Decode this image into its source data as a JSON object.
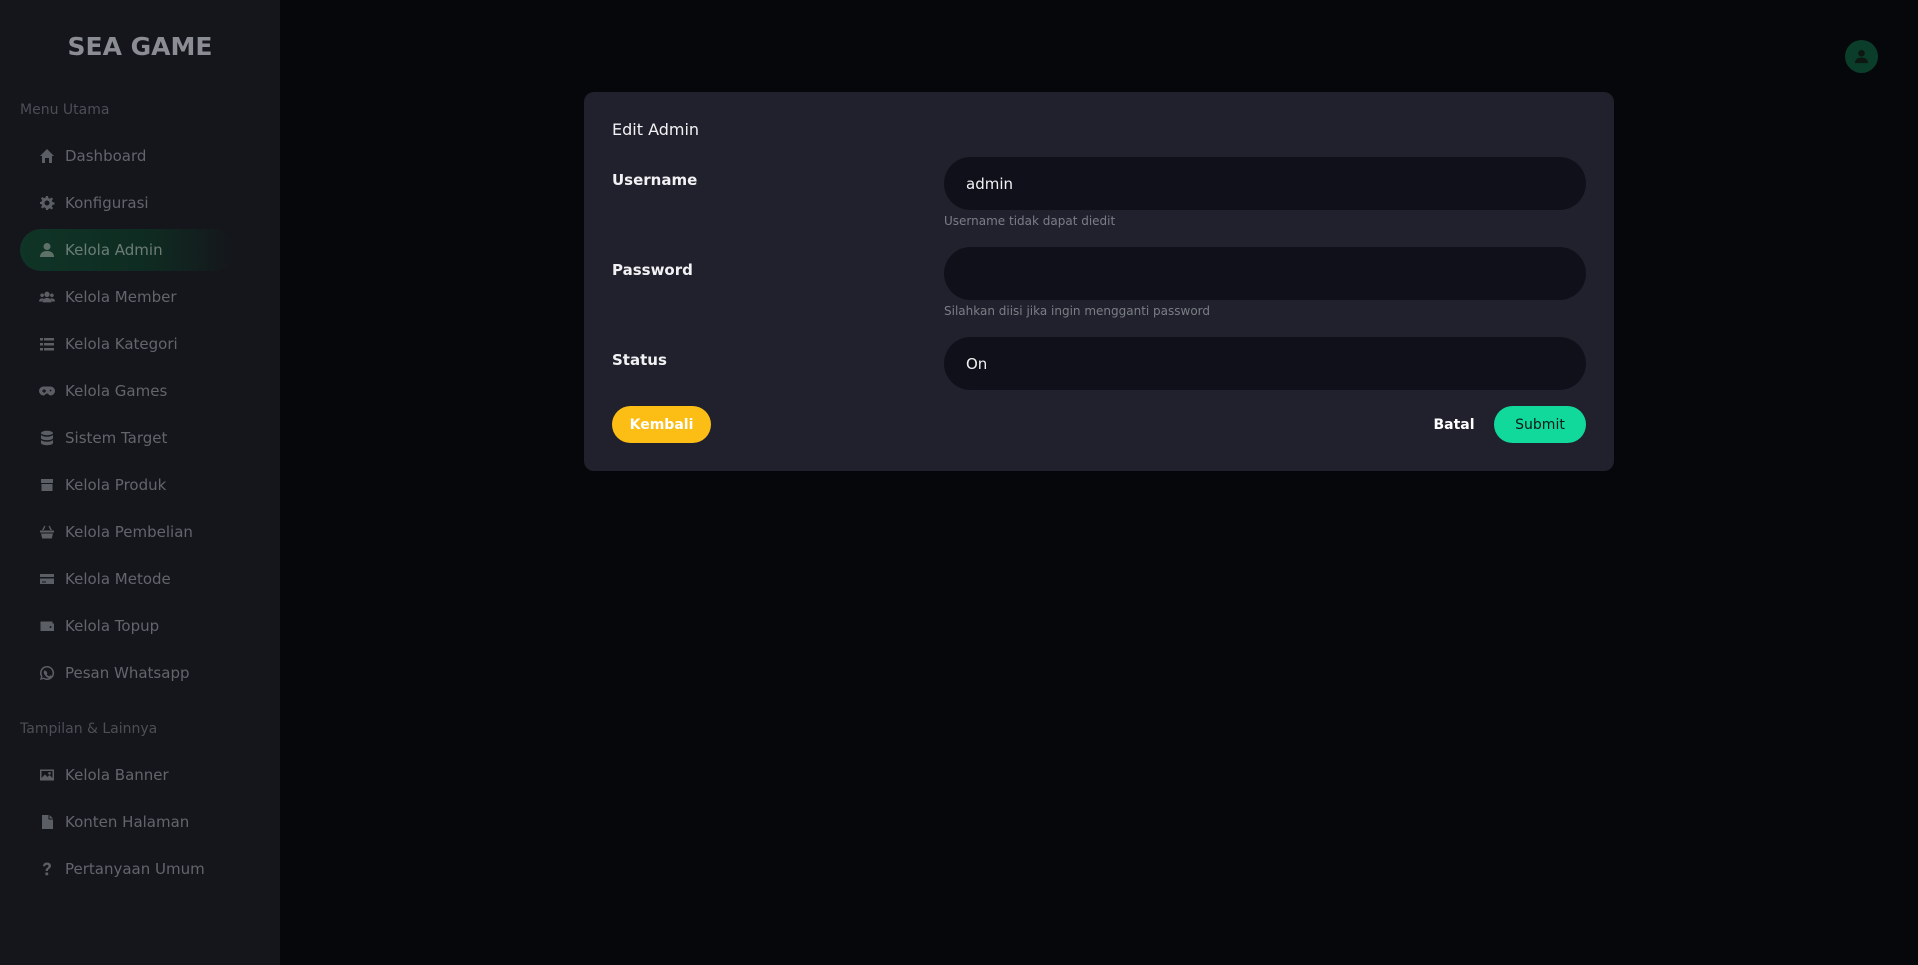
{
  "sidebar": {
    "logo": "SEA GAME",
    "sections": [
      {
        "title": "Menu Utama"
      },
      {
        "title": "Tampilan & Lainnya"
      }
    ],
    "items": [
      {
        "label": "Dashboard",
        "icon": "home-icon"
      },
      {
        "label": "Konfigurasi",
        "icon": "gear-icon"
      },
      {
        "label": "Kelola Admin",
        "icon": "user-icon",
        "active": true
      },
      {
        "label": "Kelola Member",
        "icon": "users-icon"
      },
      {
        "label": "Kelola Kategori",
        "icon": "list-icon"
      },
      {
        "label": "Kelola Games",
        "icon": "gamepad-icon"
      },
      {
        "label": "Sistem Target",
        "icon": "database-icon"
      },
      {
        "label": "Kelola Produk",
        "icon": "box-icon"
      },
      {
        "label": "Kelola Pembelian",
        "icon": "basket-icon"
      },
      {
        "label": "Kelola Metode",
        "icon": "credit-card-icon"
      },
      {
        "label": "Kelola Topup",
        "icon": "wallet-icon"
      },
      {
        "label": "Pesan Whatsapp",
        "icon": "whatsapp-icon"
      },
      {
        "label": "Kelola Banner",
        "icon": "image-icon"
      },
      {
        "label": "Konten Halaman",
        "icon": "file-icon"
      },
      {
        "label": "Pertanyaan Umum",
        "icon": "question-icon"
      }
    ]
  },
  "header": {
    "avatar_icon": "user-icon"
  },
  "modal": {
    "title": "Edit Admin",
    "username": {
      "label": "Username",
      "value": "admin",
      "hint": "Username tidak dapat diedit"
    },
    "password": {
      "label": "Password",
      "value": "",
      "hint": "Silahkan diisi jika ingin mengganti password"
    },
    "status": {
      "label": "Status",
      "value": "On"
    },
    "buttons": {
      "back": "Kembali",
      "cancel": "Batal",
      "submit": "Submit"
    }
  },
  "colors": {
    "accent": "#11d99c",
    "warning": "#fcbd15",
    "panel": "#20212c",
    "input": "#0f101a",
    "sidebar": "#15161b",
    "background": "#06070b"
  }
}
